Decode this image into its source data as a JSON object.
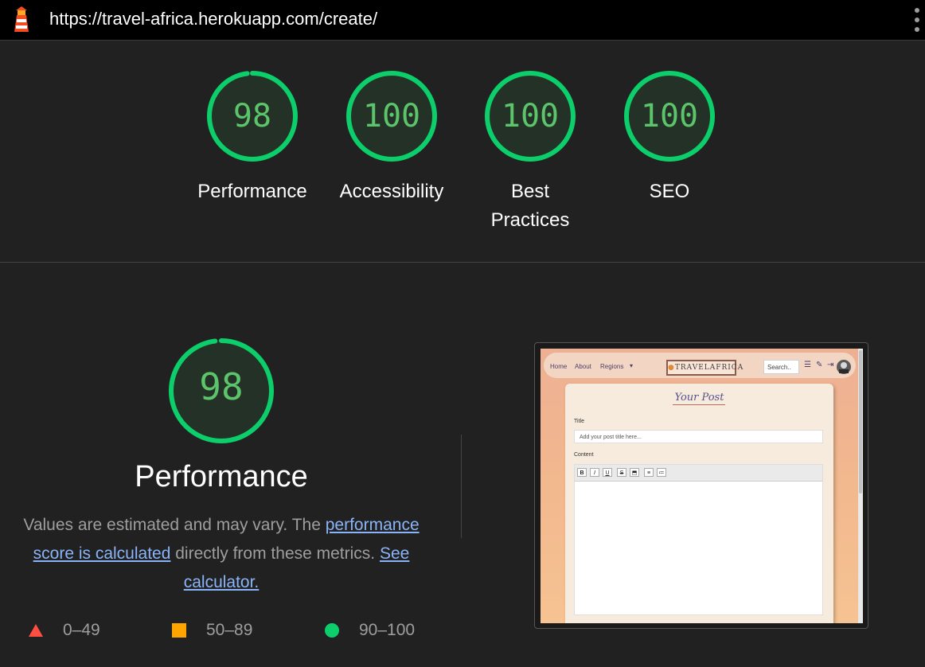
{
  "browser": {
    "url": "https://travel-africa.herokuapp.com/create/"
  },
  "colors": {
    "pass": "#0cce6b",
    "score_text": "#5cc46b",
    "link": "#8ab4f8",
    "fail": "#ff4e42",
    "average": "#ffa400"
  },
  "categories": [
    {
      "label": "Performance",
      "score": "98",
      "value": 98
    },
    {
      "label": "Accessibility",
      "score": "100",
      "value": 100
    },
    {
      "label_line1": "Best",
      "label_line2": "Practices",
      "score": "100",
      "value": 100
    },
    {
      "label": "SEO",
      "score": "100",
      "value": 100
    }
  ],
  "performance": {
    "score": "98",
    "value": 98,
    "title": "Performance",
    "desc_prefix": "Values are estimated and may vary. The ",
    "link_score": "performance score is calculated",
    "desc_middle": " directly from these metrics. ",
    "link_calculator": "See calculator."
  },
  "legend": [
    {
      "range": "0–49",
      "shape": "triangle"
    },
    {
      "range": "50–89",
      "shape": "square"
    },
    {
      "range": "90–100",
      "shape": "circle"
    }
  ],
  "thumbnail": {
    "nav_home": "Home",
    "nav_about": "About",
    "nav_regions": "Regions",
    "logo_text": "TRAVELAFRICA",
    "search_placeholder": "Search..",
    "card_title": "Your Post",
    "title_label": "Title",
    "title_placeholder": "Add your post title here...",
    "content_label": "Content",
    "toolbar": [
      "B",
      "I",
      "U",
      "S",
      "⬒",
      "≡",
      "≔"
    ]
  }
}
